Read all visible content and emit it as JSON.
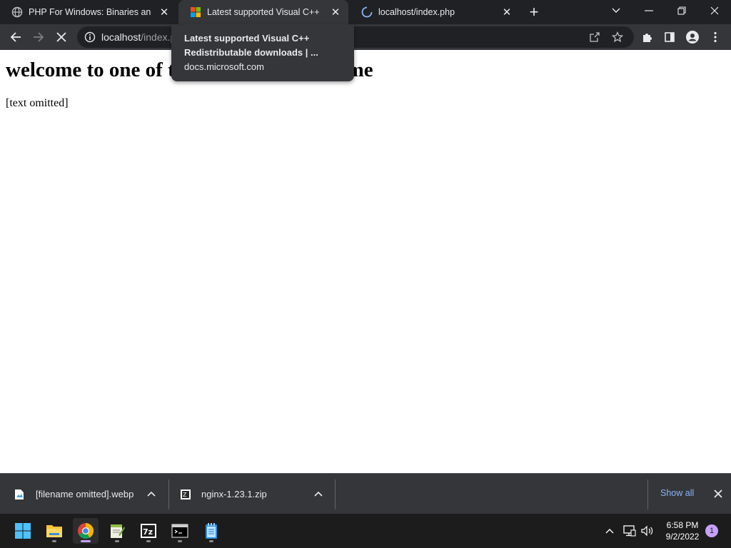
{
  "tabs": [
    {
      "title": "PHP For Windows: Binaries and sources",
      "favicon": "globe-icon",
      "state": "inactive"
    },
    {
      "title": "Latest supported Visual C++ Redistributable downloads",
      "favicon": "microsoft-logo-icon",
      "state": "active"
    },
    {
      "title": "localhost/index.php",
      "favicon": "loading-spinner-icon",
      "state": "inactive"
    }
  ],
  "toolbar": {
    "url_host": "localhost",
    "url_path": "/index.php"
  },
  "tooltip": {
    "title": "Latest supported Visual C++ Redistributable downloads | ...",
    "domain": "docs.microsoft.com"
  },
  "page": {
    "heading": "welcome to one of the best sites of all time",
    "body": "[text omitted]"
  },
  "downloads": {
    "items": [
      {
        "name": "[filename omitted].webp",
        "icon": "image-file-icon"
      },
      {
        "name": "nginx-1.23.1.zip",
        "icon": "zip-file-icon"
      }
    ],
    "show_all": "Show all"
  },
  "taskbar": {
    "apps": [
      "windows-start-icon",
      "file-explorer-icon",
      "chrome-icon",
      "notepad-plus-plus-icon",
      "7zip-icon",
      "terminal-icon",
      "notepad-icon"
    ],
    "time": "6:58 PM",
    "date": "9/2/2022",
    "notifications": "1"
  },
  "colors": {
    "tabstrip": "#202124",
    "toolbar": "#35363a",
    "accent_link": "#8ab4f8",
    "taskbar": "#1c1c1c"
  }
}
